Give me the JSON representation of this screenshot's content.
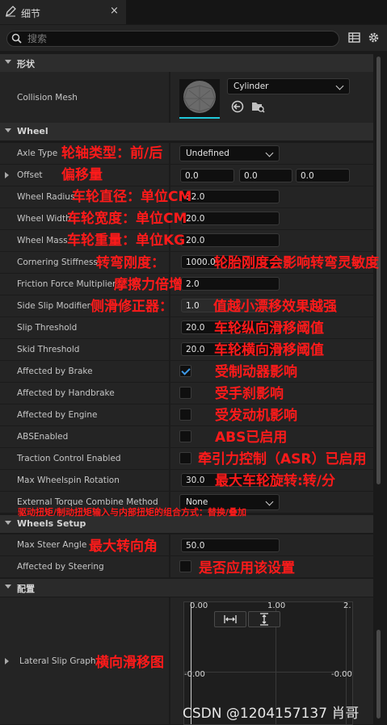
{
  "tab": {
    "title": "细节",
    "close": "×"
  },
  "search": {
    "placeholder": "搜索"
  },
  "sections": {
    "shape": "形状",
    "wheel": "Wheel",
    "wheels_setup": "Wheels Setup",
    "config": "配置"
  },
  "shape": {
    "collision_mesh_label": "Collision Mesh",
    "mesh_value": "Cylinder"
  },
  "wheel": {
    "axle_type": {
      "label": "Axle Type",
      "value": "Undefined",
      "note": "轮轴类型：前/后"
    },
    "offset": {
      "label": "Offset",
      "x": "0.0",
      "y": "0.0",
      "z": "0.0",
      "note": "偏移量"
    },
    "radius": {
      "label": "Wheel Radius",
      "value": "32.0",
      "note": "车轮直径：单位CM"
    },
    "width": {
      "label": "Wheel Width",
      "value": "20.0",
      "note": "车轮宽度：单位CM"
    },
    "mass": {
      "label": "Wheel Mass",
      "value": "20.0",
      "note": "车轮重量：单位KG"
    },
    "cornering": {
      "label": "Cornering Stiffness",
      "value": "1000.0",
      "note": "转弯刚度：",
      "note2": "轮胎刚度会影响转弯灵敏度"
    },
    "friction": {
      "label": "Friction Force Multiplier",
      "value": "2.0",
      "note": "摩擦力倍增"
    },
    "side_slip": {
      "label": "Side Slip Modifier",
      "value": "1.0",
      "note": "侧滑修正器：",
      "note2": "值越小漂移效果越强"
    },
    "slip_threshold": {
      "label": "Slip Threshold",
      "value": "20.0",
      "note": "车轮纵向滑移阈值"
    },
    "skid_threshold": {
      "label": "Skid Threshold",
      "value": "20.0",
      "note": "车轮横向滑移阈值"
    },
    "brake": {
      "label": "Affected by Brake",
      "checked": true,
      "note": "受制动器影响"
    },
    "handbrake": {
      "label": "Affected by Handbrake",
      "checked": false,
      "note": "受手刹影响"
    },
    "engine": {
      "label": "Affected by Engine",
      "checked": false,
      "note": "受发动机影响"
    },
    "abs": {
      "label": "ABSEnabled",
      "checked": false,
      "note": "ABS已启用"
    },
    "traction": {
      "label": "Traction Control Enabled",
      "checked": false,
      "note": "牵引力控制（ASR）已启用"
    },
    "max_wheelspin": {
      "label": "Max Wheelspin Rotation",
      "value": "30.0",
      "note": "最大车轮旋转:转/分"
    },
    "torque_combine": {
      "label": "External Torque Combine Method",
      "value": "None",
      "note": "驱动扭矩/制动扭矩输入与内部扭矩的组合方式：替换/叠加"
    }
  },
  "wheels_setup": {
    "max_steer": {
      "label": "Max Steer Angle",
      "value": "50.0",
      "note": "最大转向角"
    },
    "steering": {
      "label": "Affected by Steering",
      "checked": false,
      "note": "是否应用该设置"
    }
  },
  "config": {
    "lateral_slip": {
      "label": "Lateral Slip Graph",
      "note": "横向滑移图"
    },
    "graph": {
      "top_left": "0.00",
      "top_mid": "1.00",
      "top_right": "2.",
      "bottom_left": "-0.00",
      "bottom_right": "-0.00"
    }
  },
  "watermark": "CSDN @1204157137 肖哥",
  "colors": {
    "annotation": "#ff1a1a",
    "check": "#3e9ae8",
    "accent_cyan": "#1fc7d9"
  }
}
